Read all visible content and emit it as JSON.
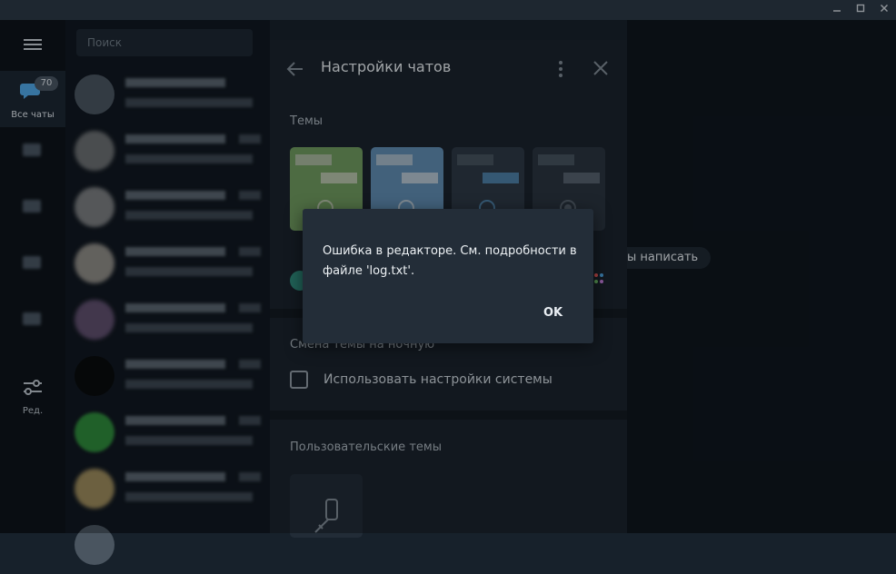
{
  "window": {
    "minimize_icon": "minimize-icon",
    "maximize_icon": "maximize-icon",
    "close_icon": "close-icon"
  },
  "folders": {
    "menu_icon": "hamburger-icon",
    "items": [
      {
        "label": "Все чаты",
        "badge": "70",
        "active": true
      },
      {
        "label": "",
        "badge": "",
        "active": false
      },
      {
        "label": "",
        "badge": "",
        "active": false
      },
      {
        "label": "",
        "badge": "",
        "active": false
      },
      {
        "label": "",
        "badge": "",
        "active": false
      }
    ],
    "edit": {
      "label": "Ред."
    }
  },
  "chatlist": {
    "search_placeholder": "Поиск"
  },
  "chat_hint": "бы написать",
  "settings": {
    "title": "Настройки чатов",
    "themes_label": "Темы",
    "night_label": "Смена темы на ночную",
    "system_checkbox_label": "Использовать настройки системы",
    "system_checkbox_checked": false,
    "custom_themes_label": "Пользовательские темы",
    "theme_colors": [
      "#6f9a5f",
      "#5f8cb0",
      "#2d3845",
      "#2a3440"
    ]
  },
  "dialog": {
    "message": "Ошибка в редакторе. См. подробности в файле 'log.txt'.",
    "ok_label": "OK"
  },
  "colors": {
    "accent": "#4fa6e6",
    "panel": "#1a232d",
    "dialog": "#232d38"
  }
}
